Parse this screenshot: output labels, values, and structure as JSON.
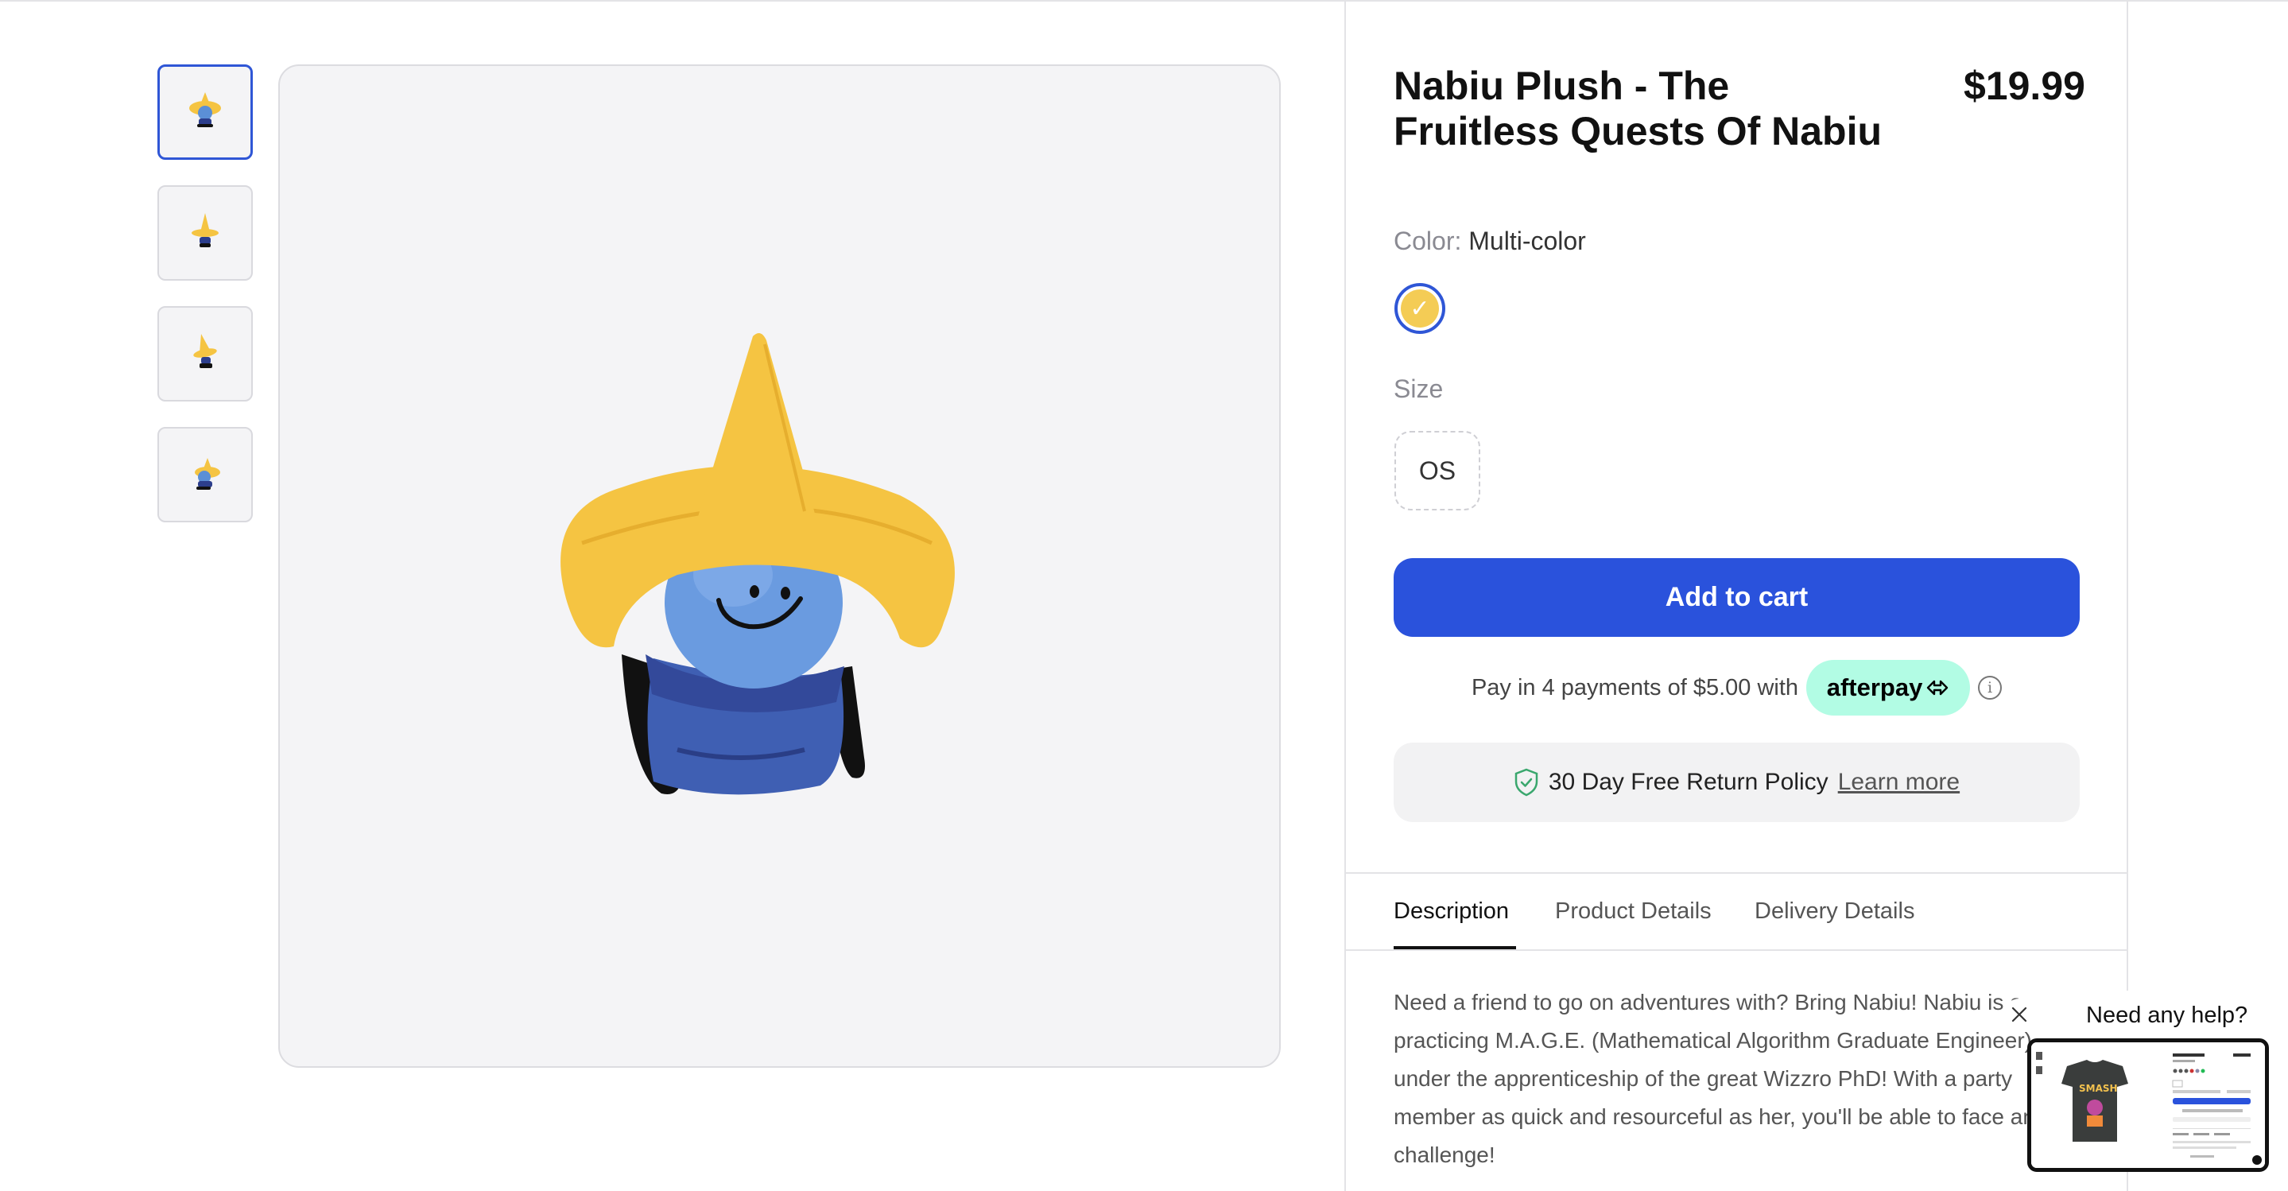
{
  "product": {
    "title": "Nabiu Plush - The Fruitless Quests Of Nabiu",
    "price": "$19.99"
  },
  "gallery": {
    "thumbnails": [
      {
        "name": "thumbnail-1",
        "selected": true
      },
      {
        "name": "thumbnail-2",
        "selected": false
      },
      {
        "name": "thumbnail-3",
        "selected": false
      },
      {
        "name": "thumbnail-4",
        "selected": false
      }
    ]
  },
  "color": {
    "label": "Color:",
    "value": "Multi-color",
    "swatch_color": "#f4cc55",
    "swatch_check": "✓"
  },
  "size": {
    "label": "Size",
    "options": [
      "OS"
    ]
  },
  "cart": {
    "button_label": "Add to cart",
    "button_color": "#2a52dc"
  },
  "payment": {
    "text": "Pay in 4 payments of $5.00 with",
    "provider": "afterpay",
    "info_glyph": "i"
  },
  "returns": {
    "text": "30 Day Free Return Policy",
    "link": "Learn more"
  },
  "tabs": [
    "Description",
    "Product Details",
    "Delivery Details"
  ],
  "active_tab": "Description",
  "description": "Need a friend to go on adventures with? Bring Nabiu! Nabiu is a practicing M.A.G.E. (Mathematical Algorithm Graduate Engineer) under the apprenticeship of the great Wizzro PhD! With a party member as quick and resourceful as her, you'll be able to face any challenge!",
  "help_widget": {
    "bubble_text": "Need any help?",
    "preview_shirt_text": "SMASH"
  },
  "icons": {
    "check": "check-icon",
    "shield": "shield-check-icon",
    "info": "info-icon",
    "close": "close-icon"
  }
}
